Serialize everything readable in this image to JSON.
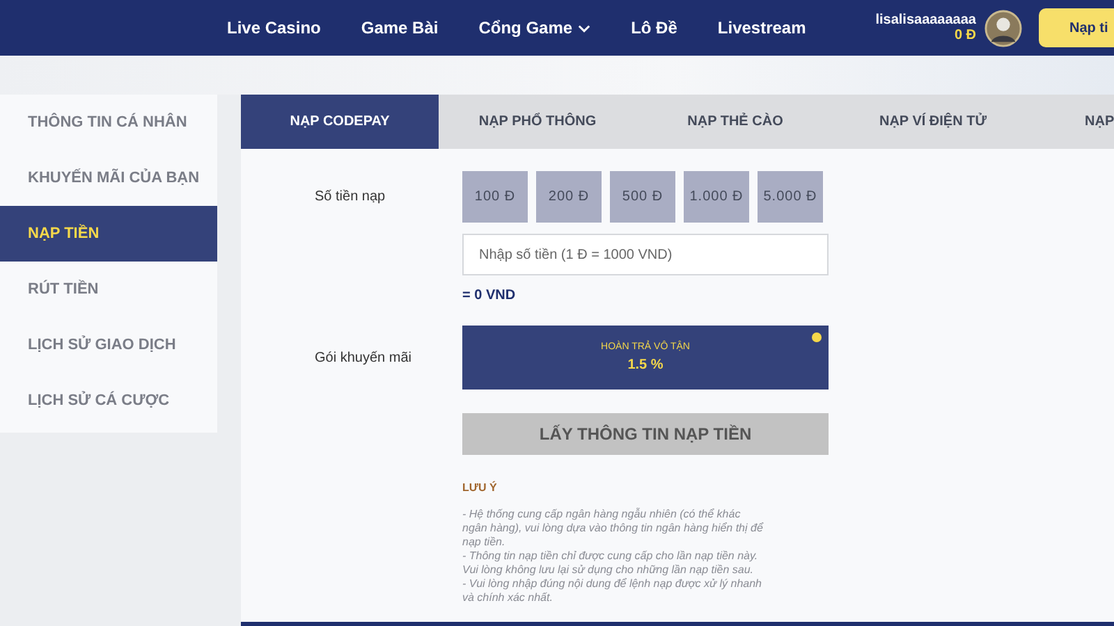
{
  "header": {
    "nav": [
      {
        "label": "Live Casino",
        "dropdown": false
      },
      {
        "label": "Game Bài",
        "dropdown": false
      },
      {
        "label": "Cổng Game",
        "dropdown": true
      },
      {
        "label": "Lô Đề",
        "dropdown": false
      },
      {
        "label": "Livestream",
        "dropdown": false
      }
    ],
    "user": {
      "name": "lisalisaaaaaaaa",
      "balance": "0 Đ"
    },
    "deposit_button": "Nạp ti"
  },
  "sidebar": {
    "items": [
      {
        "label": "THÔNG TIN CÁ NHÂN",
        "selected": false
      },
      {
        "label": "KHUYẾN MÃI CỦA BẠN",
        "selected": false
      },
      {
        "label": "NẠP TIỀN",
        "selected": true
      },
      {
        "label": "RÚT TIỀN",
        "selected": false
      },
      {
        "label": "LỊCH SỬ GIAO DỊCH",
        "selected": false
      },
      {
        "label": "LỊCH SỬ CÁ CƯỢC",
        "selected": false
      }
    ]
  },
  "tabs": [
    {
      "label": "NẠP CODEPAY",
      "selected": true
    },
    {
      "label": "NẠP PHỔ THÔNG",
      "selected": false
    },
    {
      "label": "NẠP THẺ CÀO",
      "selected": false
    },
    {
      "label": "NẠP VÍ ĐIỆN TỬ",
      "selected": false
    },
    {
      "label": "NẠP",
      "selected": false
    }
  ],
  "form": {
    "amount_label": "Số tiền nạp",
    "amounts": [
      "100 Đ",
      "200 Đ",
      "500 Đ",
      "1.000 Đ",
      "5.000 Đ"
    ],
    "amount_input": {
      "placeholder": "Nhập số tiền (1 Đ = 1000 VND)"
    },
    "converted": "= 0 VND",
    "promo_label": "Gói khuyến mãi",
    "promos": [
      {
        "title": "HOÀN TRẢ VÔ TẬN",
        "rate": "1.5 %",
        "selected": true
      }
    ],
    "submit": "LẤY THÔNG TIN NẠP TIỀN",
    "note_title": "LƯU Ý",
    "notes": [
      "- Hệ thống cung cấp ngân hàng ngẫu nhiên (có thể khác ngân hàng), vui lòng dựa vào thông tin ngân hàng hiển thị để nạp tiền.",
      "- Thông tin nạp tiền chỉ được cung cấp cho lần nạp tiền này. Vui lòng không lưu lại sử dụng cho những lần nạp tiền sau.",
      "- Vui lòng nhập đúng nội dung để lệnh nạp được xử lý nhanh và chính xác nhất."
    ]
  }
}
